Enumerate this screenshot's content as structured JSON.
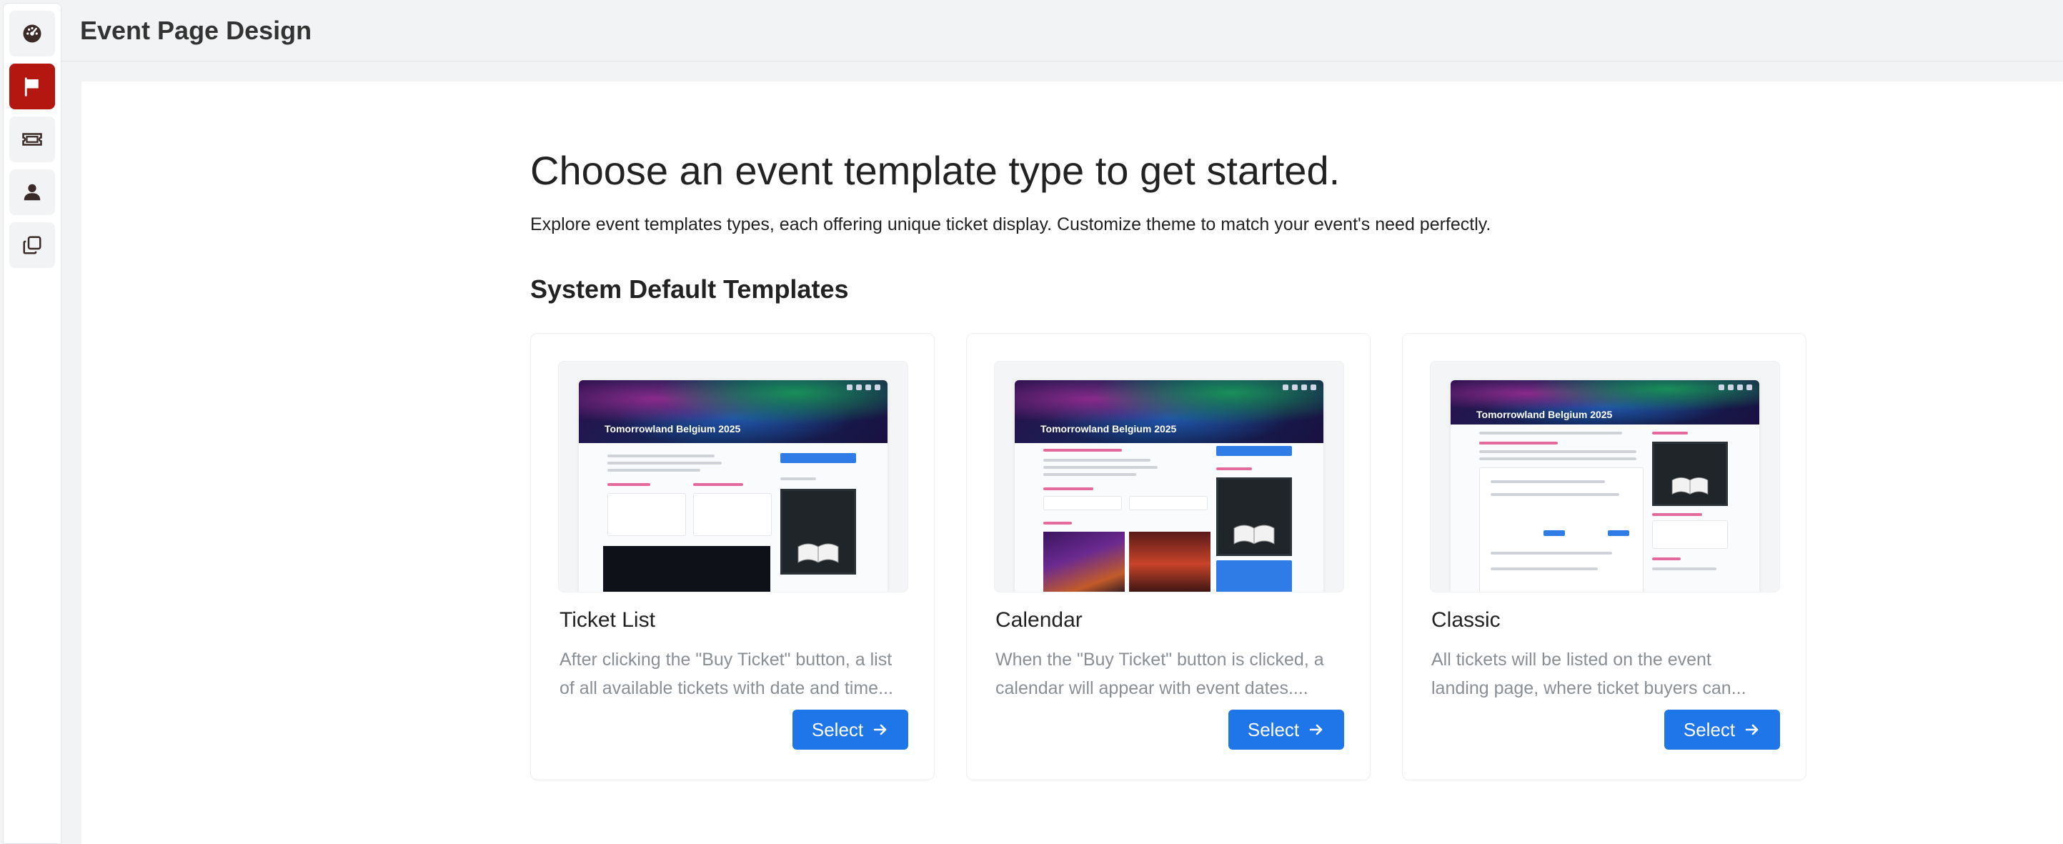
{
  "header": {
    "title": "Event Page Design"
  },
  "sidebar": {
    "items": [
      {
        "icon": "dashboard-gauge-icon",
        "active": false
      },
      {
        "icon": "flag-icon",
        "active": true
      },
      {
        "icon": "ticket-icon",
        "active": false
      },
      {
        "icon": "user-icon",
        "active": false
      },
      {
        "icon": "copy-icon",
        "active": false
      }
    ],
    "active_color": "#b3170f"
  },
  "main": {
    "headline": "Choose an event template type to get started.",
    "subtext": "Explore event templates types, each offering unique ticket display. Customize theme to match your event's need perfectly.",
    "section_title": "System Default Templates",
    "templates": [
      {
        "title": "Ticket List",
        "desc_line1": "After clicking the \"Buy Ticket\" button, a list",
        "desc_line2": "of all available tickets with date and time...",
        "button": "Select",
        "preview_title": "Tomorrowland Belgium 2025"
      },
      {
        "title": "Calendar",
        "desc_line1": "When the \"Buy Ticket\" button is clicked, a",
        "desc_line2": "calendar will appear with event dates....",
        "button": "Select",
        "preview_title": "Tomorrowland Belgium 2025"
      },
      {
        "title": "Classic",
        "desc_line1": "All tickets will be listed on the event",
        "desc_line2": "landing page, where ticket buyers can...",
        "button": "Select",
        "preview_title": "Tomorrowland Belgium 2025"
      }
    ],
    "button_color": "#1e76e8"
  }
}
